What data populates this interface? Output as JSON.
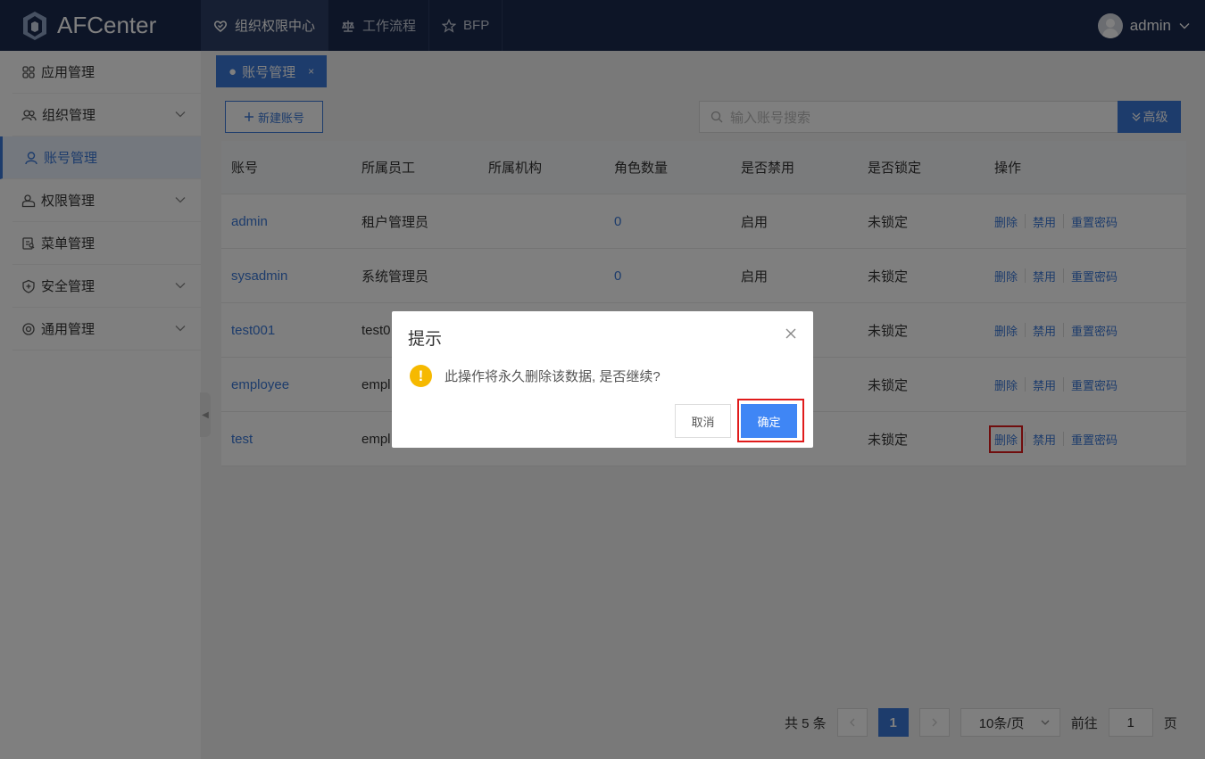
{
  "app": {
    "name": "AFCenter",
    "logo_icon": "af-logo-icon"
  },
  "topnav": [
    {
      "label": "组织权限中心",
      "icon": "heart-shield-icon",
      "active": true
    },
    {
      "label": "工作流程",
      "icon": "scale-icon",
      "active": false
    },
    {
      "label": "BFP",
      "icon": "star-icon",
      "active": false
    }
  ],
  "user": {
    "name": "admin"
  },
  "sidebar": [
    {
      "label": "应用管理",
      "icon": "grid-icon",
      "expandable": false,
      "active": false
    },
    {
      "label": "组织管理",
      "icon": "group-icon",
      "expandable": true,
      "active": false
    },
    {
      "label": "账号管理",
      "icon": "user-icon",
      "expandable": false,
      "active": true
    },
    {
      "label": "权限管理",
      "icon": "permission-icon",
      "expandable": true,
      "active": false
    },
    {
      "label": "菜单管理",
      "icon": "menu-doc-icon",
      "expandable": false,
      "active": false
    },
    {
      "label": "安全管理",
      "icon": "shield-plus-icon",
      "expandable": true,
      "active": false
    },
    {
      "label": "通用管理",
      "icon": "gear-icon",
      "expandable": true,
      "active": false
    }
  ],
  "tab": {
    "label": "账号管理",
    "close": "×"
  },
  "toolbar": {
    "new_label": "新建账号",
    "search_placeholder": "输入账号搜索",
    "advanced_label": "高级"
  },
  "table": {
    "headers": [
      "账号",
      "所属员工",
      "所属机构",
      "角色数量",
      "是否禁用",
      "是否锁定",
      "操作"
    ],
    "rows": [
      {
        "account": "admin",
        "employee": "租户管理员",
        "org": "",
        "roles": "0",
        "disabled": "启用",
        "locked": "未锁定"
      },
      {
        "account": "sysadmin",
        "employee": "系统管理员",
        "org": "",
        "roles": "0",
        "disabled": "启用",
        "locked": "未锁定"
      },
      {
        "account": "test001",
        "employee": "test0",
        "org": "",
        "roles": "",
        "disabled": "",
        "locked": "未锁定"
      },
      {
        "account": "employee",
        "employee": "empl",
        "org": "",
        "roles": "",
        "disabled": "",
        "locked": "未锁定"
      },
      {
        "account": "test",
        "employee": "empl",
        "org": "",
        "roles": "",
        "disabled": "",
        "locked": "未锁定"
      }
    ],
    "ops": {
      "delete": "删除",
      "disable": "禁用",
      "reset": "重置密码"
    }
  },
  "pager": {
    "total": "共 5 条",
    "current": "1",
    "size": "10条/页",
    "goto_label": "前往",
    "goto_value": "1",
    "page_suffix": "页"
  },
  "dialog": {
    "title": "提示",
    "message": "此操作将永久删除该数据, 是否继续?",
    "warn": "!",
    "cancel": "取消",
    "ok": "确定"
  }
}
